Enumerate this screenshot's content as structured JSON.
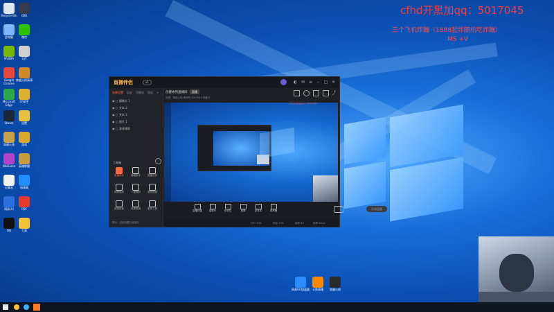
{
  "overlay": {
    "title": "cfhd开黑加qq：5017045",
    "line1": "三个飞机炸蹦（1888起炸随机吃炸蹦）",
    "line2": "MS +V"
  },
  "desktop_icons": [
    {
      "label": "Recycle Bin",
      "color": "#dfe6ee"
    },
    {
      "label": "此电脑",
      "color": "#7fb7ff"
    },
    {
      "label": "NVIDIA",
      "color": "#76b900"
    },
    {
      "label": "Google Chrome",
      "color": "#e8453c"
    },
    {
      "label": "Microsoft Edge",
      "color": "#2ba84a"
    },
    {
      "label": "Steam",
      "color": "#1b2838"
    },
    {
      "label": "穿越火线",
      "color": "#c8a04a"
    },
    {
      "label": "WeGame",
      "color": "#b041c8"
    },
    {
      "label": "记事本",
      "color": "#f0f0f0"
    },
    {
      "label": "网易UU",
      "color": "#2a6fdb"
    },
    {
      "label": "QQ",
      "color": "#111111"
    },
    {
      "label": "OBS",
      "color": "#333b4d"
    },
    {
      "label": "微信",
      "color": "#2dc100"
    },
    {
      "label": "文件",
      "color": "#d0d0d0"
    },
    {
      "label": "穿越火线高清",
      "color": "#d08a2a"
    },
    {
      "label": "CF助手",
      "color": "#e0b030"
    },
    {
      "label": "设置",
      "color": "#e6c040"
    },
    {
      "label": "游戏",
      "color": "#d9a82a"
    },
    {
      "label": "英雄联盟",
      "color": "#c89b3c"
    },
    {
      "label": "加速器",
      "color": "#1f8fff"
    },
    {
      "label": "PDF",
      "color": "#e23a2e"
    },
    {
      "label": "工具",
      "color": "#f2c335"
    }
  ],
  "center_icons": [
    {
      "label": "网易UU加速器",
      "color": "#2a8cff"
    },
    {
      "label": "斗鱼直播",
      "color": "#ff8a00"
    },
    {
      "label": "穿越火线",
      "color": "#2b2b2b"
    }
  ],
  "app": {
    "brand": "直播伴侣",
    "version": "v1",
    "source_tabs": [
      "场景设置",
      "历史",
      "可视化",
      "导出"
    ],
    "sources": [
      "摄像头 1",
      "文本 2",
      "文本 1",
      "图片 1",
      "游戏捕获"
    ],
    "tools_title": "工具箱",
    "tools": [
      {
        "label": "直播助手",
        "hot": true
      },
      {
        "label": "弹幕助手",
        "hot": false
      },
      {
        "label": "直播任务",
        "hot": false
      },
      {
        "label": "视频画质",
        "hot": false
      },
      {
        "label": "一键美颜",
        "hot": false
      },
      {
        "label": "录制视频",
        "hot": false
      },
      {
        "label": "虚拟形象",
        "hot": false
      },
      {
        "label": "录屏剪辑",
        "hot": false
      },
      {
        "label": "更多工具",
        "hot": false
      }
    ],
    "left_footer": "提示：当前设置已经保存",
    "main_title": "创建你的直播间",
    "main_tag": "直播",
    "main_meta": "分类：穿越火线  房间号 5017045  热度 0",
    "controls": [
      "直播设置",
      "摄像头",
      "多机位",
      "投屏",
      "麦克风",
      "扬声器"
    ],
    "go_live": "开始直播",
    "status": [
      "CPU 30%",
      "内存 43%",
      "帧率 60",
      "码率 0kb/s"
    ]
  }
}
